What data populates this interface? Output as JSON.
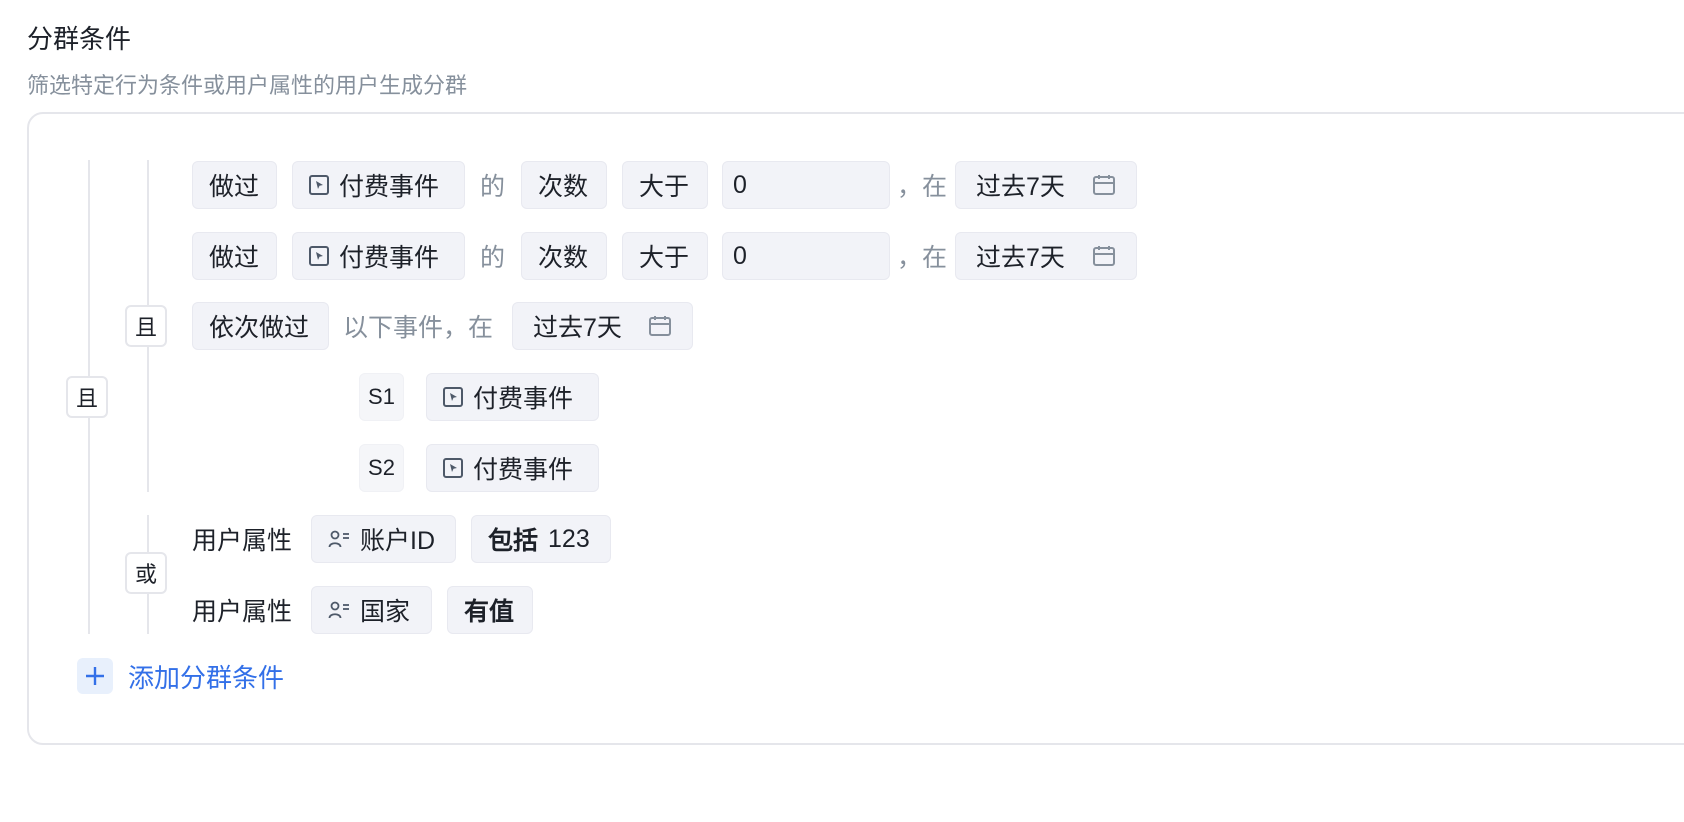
{
  "header": {
    "title": "分群条件",
    "description": "筛选特定行为条件或用户属性的用户生成分群"
  },
  "logic": {
    "outer": "且",
    "group1": "且",
    "group2": "或"
  },
  "rows": {
    "r1": {
      "action": "做过",
      "event": "付费事件",
      "of": "的",
      "metric": "次数",
      "operator": "大于",
      "value": "0",
      "comma": "，在",
      "date": "过去7天"
    },
    "r2": {
      "action": "做过",
      "event": "付费事件",
      "of": "的",
      "metric": "次数",
      "operator": "大于",
      "value": "0",
      "comma": "，在",
      "date": "过去7天"
    },
    "r3": {
      "action": "依次做过",
      "text": "以下事件，在",
      "date": "过去7天"
    },
    "s1": {
      "step": "S1",
      "event": "付费事件"
    },
    "s2": {
      "step": "S2",
      "event": "付费事件"
    },
    "p1": {
      "label": "用户属性",
      "property": "账户ID",
      "operator": "包括",
      "value": "123"
    },
    "p2": {
      "label": "用户属性",
      "property": "国家",
      "operator": "有值"
    }
  },
  "add_condition_label": "添加分群条件",
  "colors": {
    "accent": "#3370e8",
    "chip_bg": "#f2f3f8",
    "muted": "#86909c",
    "border": "#e5e6eb"
  },
  "icons": {
    "event": "event-cursor-icon",
    "date": "calendar-icon",
    "user_property": "user-property-icon",
    "add": "plus-icon"
  }
}
